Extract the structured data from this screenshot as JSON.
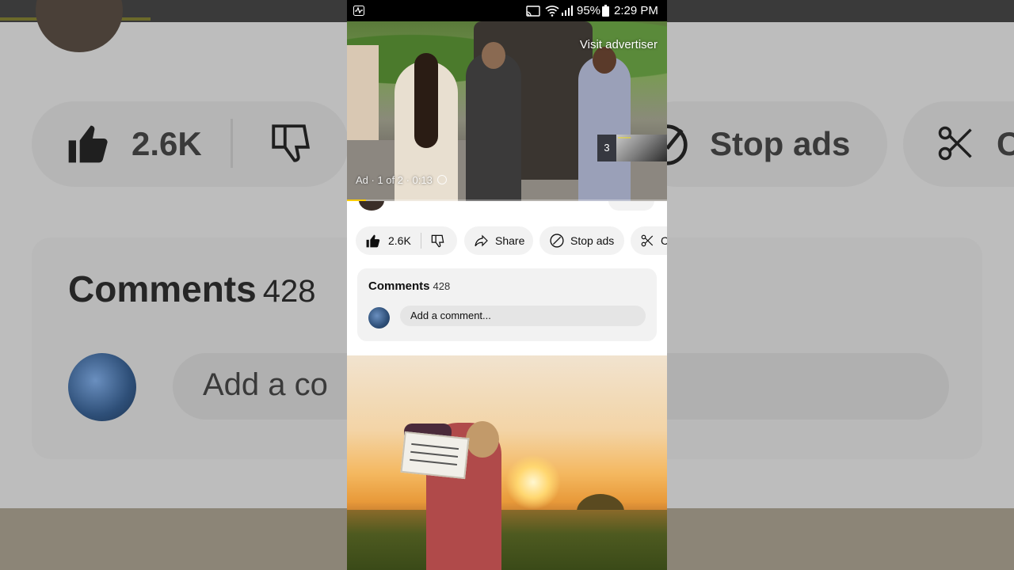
{
  "status_bar": {
    "battery": "95%",
    "time": "2:29 PM"
  },
  "video": {
    "visit_advertiser": "Visit advertiser",
    "ad_info": "Ad · 1 of 2 · 0:13",
    "queue_count": "3",
    "ad_progress": 0.06
  },
  "actions": {
    "like_count": "2.6K",
    "share_label": "Share",
    "stop_ads_label": "Stop ads",
    "clip_label": "C"
  },
  "comments": {
    "title": "Comments",
    "count": "428",
    "placeholder": "Add a comment..."
  },
  "background": {
    "like_count": "2.6K",
    "stop_ads": "Stop ads",
    "clip": "C",
    "comments": "Comments",
    "comments_count": "428",
    "add_comment": "Add a co"
  },
  "colors": {
    "accent": "#ffcc00",
    "pill_bg": "#f2f2f2"
  }
}
